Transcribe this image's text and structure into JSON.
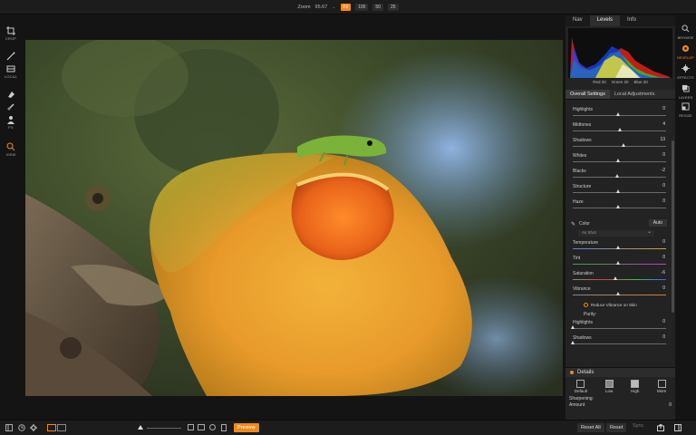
{
  "topbar": {
    "zoom_label": "Zoom",
    "zoom_value": "95.67",
    "zoom_caret": "⌄",
    "zoom_buttons": [
      {
        "label": "Fit",
        "active": true
      },
      {
        "label": "100",
        "active": false
      },
      {
        "label": "50",
        "active": false
      },
      {
        "label": "25",
        "active": false
      }
    ]
  },
  "left_tools": [
    {
      "icon": "crop-icon",
      "label": "CROP"
    },
    {
      "icon": "brush-icon",
      "label": ""
    },
    {
      "icon": "local-icon",
      "label": "LOCAL"
    },
    {
      "icon": "perfect-eraser-icon",
      "label": ""
    },
    {
      "icon": "retouch-icon",
      "label": ""
    },
    {
      "icon": "portrait-icon",
      "label": "FX"
    },
    {
      "icon": "zoom-icon",
      "label": "VIEW"
    }
  ],
  "panel": {
    "top_tabs": [
      "Nav",
      "Levels",
      "Info"
    ],
    "active_top_tab": "Levels",
    "rgb": {
      "red": "Red 20",
      "green": "Green 20",
      "blue": "Blue 20"
    },
    "sub_tabs": [
      "Overall Settings",
      "Local Adjustments"
    ],
    "active_sub_tab": "Overall Settings",
    "sliders": [
      {
        "name": "Highlights",
        "value": "0",
        "pos": 0.5
      },
      {
        "name": "Midtones",
        "value": "4",
        "pos": 0.52
      },
      {
        "name": "Shadows",
        "value": "13",
        "pos": 0.56
      },
      {
        "name": "Whites",
        "value": "0",
        "pos": 0.5
      },
      {
        "name": "Blacks",
        "value": "-2",
        "pos": 0.49
      },
      {
        "name": "Structure",
        "value": "0",
        "pos": 0.5
      },
      {
        "name": "Haze",
        "value": "0",
        "pos": 0.5
      }
    ],
    "color_label": "Color",
    "auto_label": "Auto",
    "as_shot_label": "As Shot",
    "color_sliders": [
      {
        "name": "Temperature",
        "value": "0",
        "pos": 0.5
      },
      {
        "name": "Tint",
        "value": "0",
        "pos": 0.5
      },
      {
        "name": "Saturation",
        "value": "-6",
        "pos": 0.47
      },
      {
        "name": "Vibrance",
        "value": "0",
        "pos": 0.5
      }
    ],
    "reduce_vibrance_label": "Reduce Vibrance on Skin",
    "purity_label": "Purity:",
    "purity_sliders": [
      {
        "name": "Highlights",
        "value": "0",
        "pos": 0.0
      },
      {
        "name": "Shadows",
        "value": "0",
        "pos": 0.0
      }
    ],
    "details": {
      "title": "Details",
      "buttons": [
        "Default",
        "Low",
        "High",
        "More"
      ],
      "sharpening_label": "Sharpening:",
      "amount_label": "Amount",
      "amount_value": "0"
    }
  },
  "right_tools": [
    {
      "icon": "browse-icon",
      "label": "BROWSE"
    },
    {
      "icon": "develop-icon",
      "label": "DEVELOP",
      "active": true
    },
    {
      "icon": "effects-icon",
      "label": "EFFECTS"
    },
    {
      "icon": "layers-icon",
      "label": "LAYERS"
    },
    {
      "icon": "resize-icon",
      "label": "RESIZE"
    }
  ],
  "bottombar": {
    "preview_label": "Preview",
    "reset_all_label": "Reset All",
    "reset_label": "Reset",
    "sync_label": "Sync"
  },
  "colors": {
    "accent": "#f08a1c",
    "panel_bg": "#232323",
    "app_bg": "#141414"
  }
}
